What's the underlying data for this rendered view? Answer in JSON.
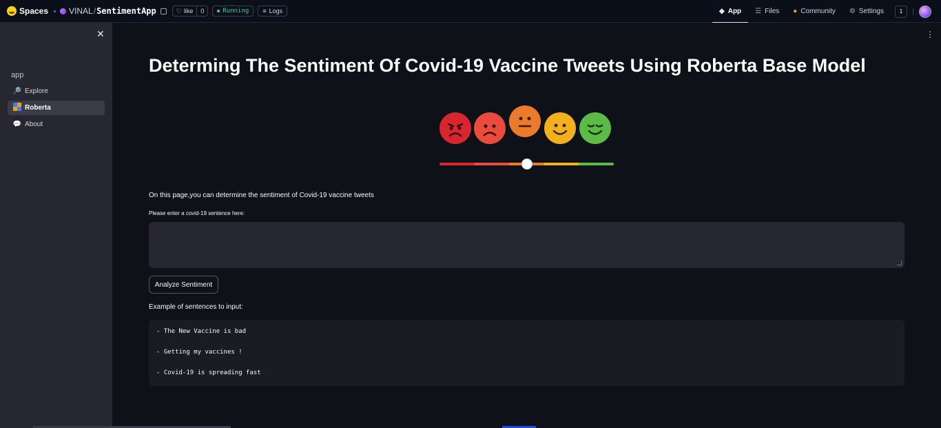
{
  "topbar": {
    "brand": "Spaces",
    "owner": "VINAL",
    "separator": "/",
    "repo_name": "SentimentApp",
    "like_label": "like",
    "like_count": "0",
    "status": "Running",
    "logs_label": "Logs",
    "nav": [
      {
        "label": "App",
        "icon": "cube-icon",
        "active": true
      },
      {
        "label": "Files",
        "icon": "files-icon",
        "active": false
      },
      {
        "label": "Community",
        "icon": "community-icon",
        "active": false
      },
      {
        "label": "Settings",
        "icon": "gear-icon",
        "active": false
      }
    ],
    "notification_count": "1"
  },
  "sidebar": {
    "title": "app",
    "items": [
      {
        "label": "Explore",
        "icon": "magnifier-icon",
        "active": false
      },
      {
        "label": "Roberta",
        "icon": "roberta-icon",
        "active": true
      },
      {
        "label": "About",
        "icon": "speech-bubble-icon",
        "active": false
      }
    ]
  },
  "main": {
    "title": "Determing The Sentiment Of Covid-19 Vaccine Tweets Using Roberta Base Model",
    "sentiment_scale": {
      "faces": [
        "angry",
        "sad",
        "neutral",
        "happy",
        "very-happy"
      ],
      "colors": [
        "#d7262e",
        "#e84c3d",
        "#ea7b2b",
        "#f2b01e",
        "#5cba47"
      ],
      "selected_index": 2,
      "slider_value": 0.5
    },
    "description": "On this page,you can determine the sentiment of Covid-19 vaccine tweets",
    "input_label": "Please enter a covid-19 sentence here:",
    "input_value": "",
    "analyze_button": "Analyze Sentiment",
    "examples_title": "Example of sentences to input:",
    "examples": [
      "- The New Vaccine is bad",
      "- Getting my vaccines !",
      "- Covid-19 is spreading fast"
    ]
  }
}
